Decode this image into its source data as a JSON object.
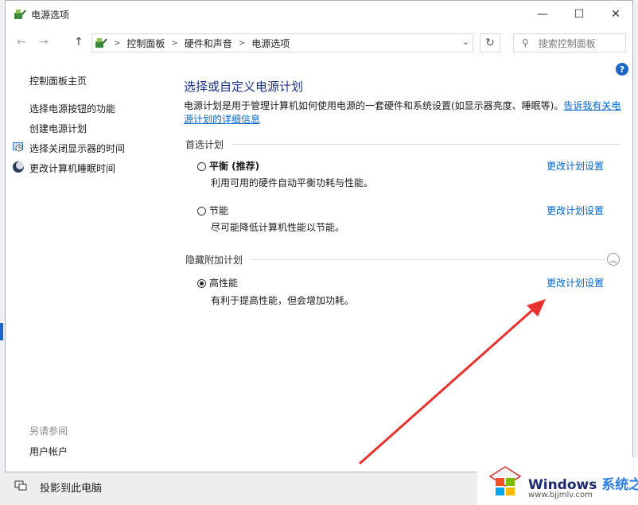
{
  "window": {
    "title": "电源选项",
    "controls": {
      "minimize": "—",
      "maximize": "☐",
      "close": "✕"
    }
  },
  "nav": {
    "back": "←",
    "forward": "→",
    "up": "↑",
    "breadcrumbs": [
      "控制面板",
      "硬件和声音",
      "电源选项"
    ],
    "dropdown": "⌄",
    "refresh": "↻",
    "search_placeholder": "搜索控制面板"
  },
  "help": "?",
  "sidebar": {
    "items": [
      {
        "label": "控制面板主页"
      },
      {
        "label": "选择电源按钮的功能"
      },
      {
        "label": "创建电源计划"
      },
      {
        "label": "选择关闭显示器的时间"
      },
      {
        "label": "更改计算机睡眠时间"
      }
    ],
    "see_also_heading": "另请参阅",
    "see_also_items": [
      {
        "label": "用户帐户"
      }
    ]
  },
  "main": {
    "title": "选择或自定义电源计划",
    "description": "电源计划是用于管理计算机如何使用电源的一套硬件和系统设置(如显示器亮度、睡眠等)。",
    "description_link_1": "告诉我有关电",
    "description_link_2": "源计划的详细信息",
    "preferred_heading": "首选计划",
    "hidden_heading": "隐藏附加计划",
    "collapse_icon": "︿",
    "plans": [
      {
        "name": "平衡 (推荐)",
        "description": "利用可用的硬件自动平衡功耗与性能。",
        "change_label": "更改计划设置",
        "selected": false
      },
      {
        "name": "节能",
        "description": "尽可能降低计算机性能以节能。",
        "change_label": "更改计划设置",
        "selected": false
      },
      {
        "name": "高性能",
        "description": "有利于提高性能，但会增加功耗。",
        "change_label": "更改计划设置",
        "selected": true
      }
    ]
  },
  "taskbar": {
    "project_label": "投影到此电脑"
  },
  "watermark": {
    "brand": "Windows",
    "brand_cn": "系统之家",
    "url": "www.bjjmlv.com"
  },
  "colors": {
    "link": "#0066cc",
    "title": "#1e3287",
    "arrow": "#e8322e",
    "accent": "#1c66c6"
  }
}
